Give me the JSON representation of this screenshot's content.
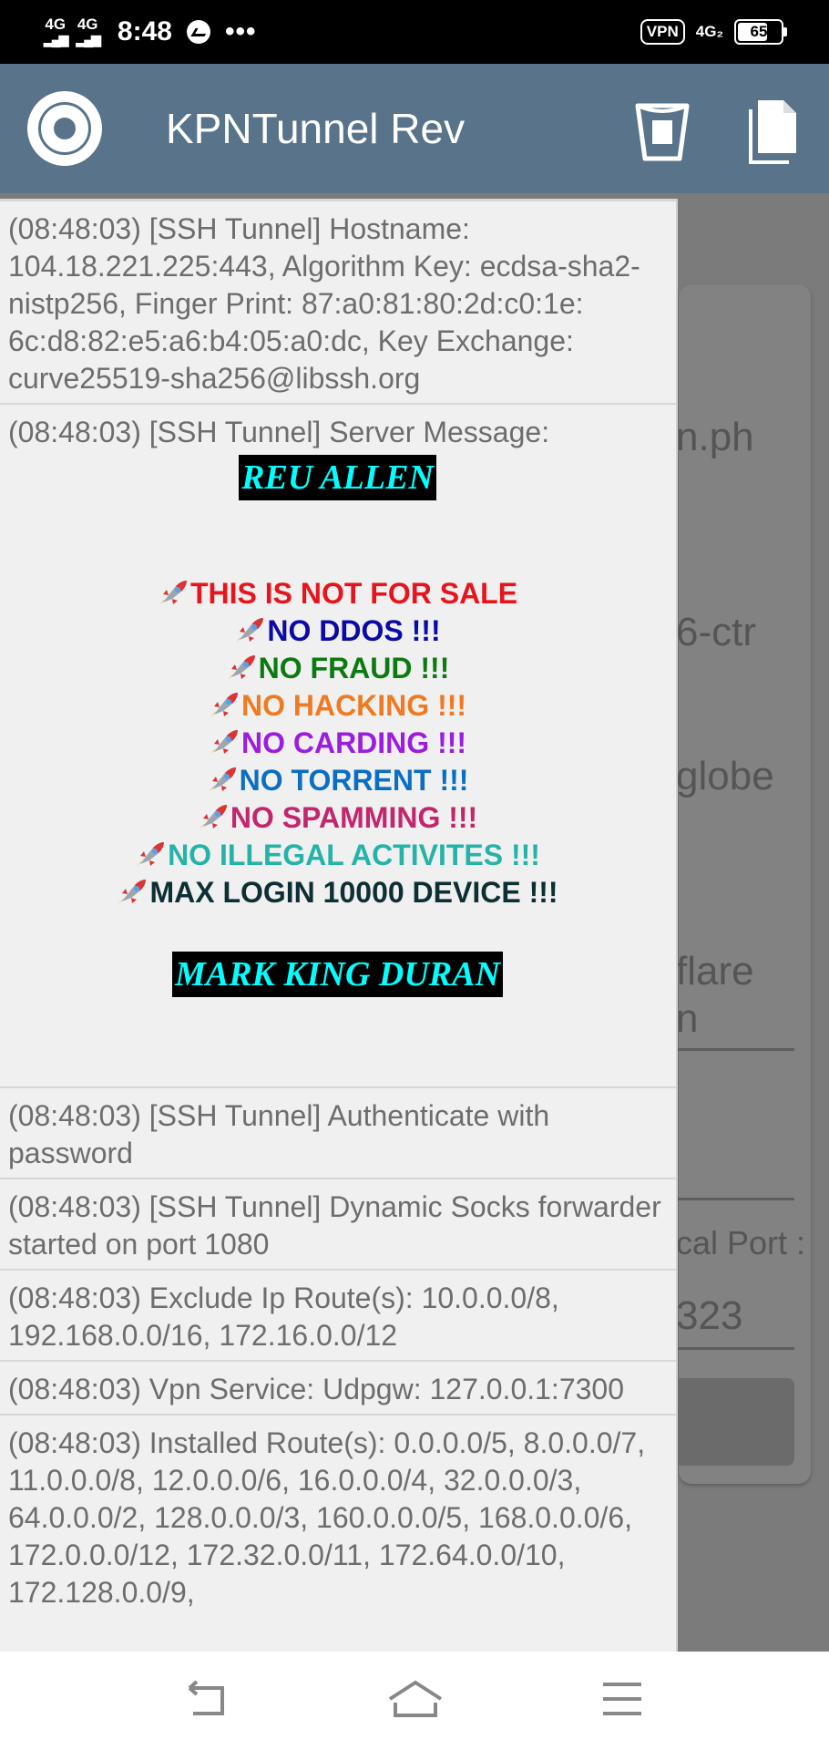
{
  "status_bar": {
    "signal1": "4G",
    "signal2": "4G",
    "time": "8:48",
    "dots": "•••",
    "vpn": "VPN",
    "network": "4G₂",
    "battery": "65"
  },
  "app_bar": {
    "title": "KPNTunnel Rev",
    "icons": [
      "clear-log-icon",
      "copy-log-icon"
    ]
  },
  "background": {
    "fragments": [
      "n.ph",
      "6-ctr",
      "globe",
      "flare",
      "n",
      "cal Port :",
      "323"
    ]
  },
  "log": {
    "entries": [
      "(08:48:03) [SSH Tunnel] Hostname: 104.18.221.225:443, Algorithm Key: ecdsa-sha2-nistp256, Finger Print: 87:a0:81:80:2d:c0:1e:\n6c:d8:82:e5:a6:b4:05:a0:dc, Key Exchange: curve25519-sha256@libssh.org",
      "(08:48:03) [SSH Tunnel] Authenticate with password",
      "(08:48:03) [SSH Tunnel] Dynamic Socks forwarder started on port 1080",
      "(08:48:03) Exclude Ip Route(s): 10.0.0.0/8, 192.168.0.0/16, 172.16.0.0/12",
      "(08:48:03) Vpn Service: Udpgw: 127.0.0.1:7300",
      "(08:48:03) Installed Route(s): 0.0.0.0/5, 8.0.0.0/7, 11.0.0.0/8, 12.0.0.0/6, 16.0.0.0/4, 32.0.0.0/3, 64.0.0.0/2, 128.0.0.0/3, 160.0.0.0/5, 168.0.0.0/6, 172.0.0.0/12, 172.32.0.0/11, 172.64.0.0/10, 172.128.0.0/9,"
    ],
    "server_message": {
      "header": "(08:48:03) [SSH Tunnel] Server Message:",
      "banner_top": "REU ALLEN",
      "banner_bottom": "MARK KING DURAN",
      "rules": [
        {
          "text": "THIS IS NOT FOR SALE",
          "color": "#e8141d"
        },
        {
          "text": "NO DDOS !!!",
          "color": "#0a0aa8"
        },
        {
          "text": "NO FRAUD !!!",
          "color": "#0c7a10"
        },
        {
          "text": "NO HACKING !!!",
          "color": "#f07a22"
        },
        {
          "text": "NO CARDING !!!",
          "color": "#9b1ee0"
        },
        {
          "text": "NO TORRENT !!!",
          "color": "#0a6fc4"
        },
        {
          "text": "NO SPAMMING !!!",
          "color": "#c3266c"
        },
        {
          "text": "NO ILLEGAL ACTIVITES !!!",
          "color": "#25b3a8"
        },
        {
          "text": "MAX LOGIN 10000 DEVICE !!!",
          "color": "#0d2f33"
        }
      ]
    }
  },
  "nav_bar": {
    "icons": [
      "back-icon",
      "home-icon",
      "menu-icon"
    ]
  }
}
